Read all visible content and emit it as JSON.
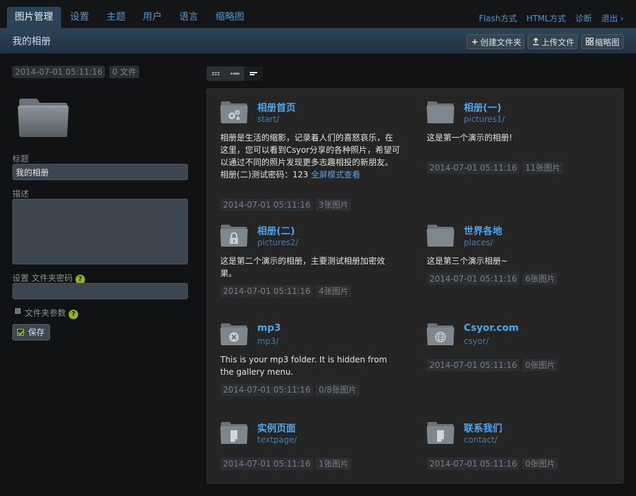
{
  "nav": {
    "tabs": [
      {
        "label": "图片管理",
        "active": true
      },
      {
        "label": "设置"
      },
      {
        "label": "主题"
      },
      {
        "label": "用户"
      },
      {
        "label": "语言"
      },
      {
        "label": "缩略图"
      }
    ],
    "links": [
      "Flash方式",
      "HTML方式",
      "诊断",
      "退出 ›"
    ]
  },
  "titlebar": {
    "title": "我的相册",
    "buttons": [
      {
        "label": "创建文件夹",
        "icon": "plus-icon"
      },
      {
        "label": "上传文件",
        "icon": "upload-icon"
      },
      {
        "label": "缩略图",
        "icon": "grid-icon"
      }
    ]
  },
  "folder": {
    "date": "2014-07-01 05:11:16",
    "file_count": "0 文件",
    "title_label": "标题",
    "title_value": "我的相册",
    "desc_label": "描述",
    "desc_value": "",
    "password_label": "设置 文件夹密码",
    "params_label": "文件夹参数",
    "help_mark": "?",
    "save_label": "保存"
  },
  "albums": [
    {
      "name": "相册首页",
      "path": "start/",
      "icon": "settings-folder-icon",
      "desc": "相册是生活的缩影，记录着人们的喜怒哀乐，在这里，您可以看到Csyor分享的各种照片，希望可以通过不同的照片发现更多志趣相投的新朋友。相册(二)测试密码：123",
      "link": "全屏模式查看",
      "date": "2014-07-01 05:11:16",
      "count": "3张图片"
    },
    {
      "name": "相册(一)",
      "path": "pictures1/",
      "icon": "folder-icon",
      "desc": "这是第一个演示的相册!",
      "link": "",
      "date": "2014-07-01 05:11:16",
      "count": "11张图片"
    },
    {
      "name": "相册(二)",
      "path": "pictures2/",
      "icon": "locked-folder-icon",
      "desc": "这是第二个演示的相册，主要测试相册加密效果。",
      "link": "",
      "date": "2014-07-01 05:11:16",
      "count": "4张图片"
    },
    {
      "name": "世界各地",
      "path": "places/",
      "icon": "folder-icon",
      "desc": "这是第三个演示相册~",
      "link": "",
      "date": "2014-07-01 05:11:16",
      "count": "6张图片"
    },
    {
      "name": "mp3",
      "path": "mp3/",
      "icon": "hidden-folder-icon",
      "desc": "This is your mp3 folder. It is hidden from the gallery menu.",
      "link": "",
      "date": "2014-07-01 05:11:16",
      "count": "0/8张图片"
    },
    {
      "name": "Csyor.com",
      "path": "csyor/",
      "icon": "globe-folder-icon",
      "desc": "",
      "link": "",
      "date": "2014-07-01 05:11:16",
      "count": "0张图片"
    },
    {
      "name": "实例页面",
      "path": "textpage/",
      "icon": "page-folder-icon",
      "desc": "",
      "link": "",
      "date": "2014-07-01 05:11:16",
      "count": "1张图片"
    },
    {
      "name": "联系我们",
      "path": "contact/",
      "icon": "page-folder-icon",
      "desc": "",
      "link": "",
      "date": "2014-07-01 05:11:16",
      "count": "0张图片"
    }
  ]
}
